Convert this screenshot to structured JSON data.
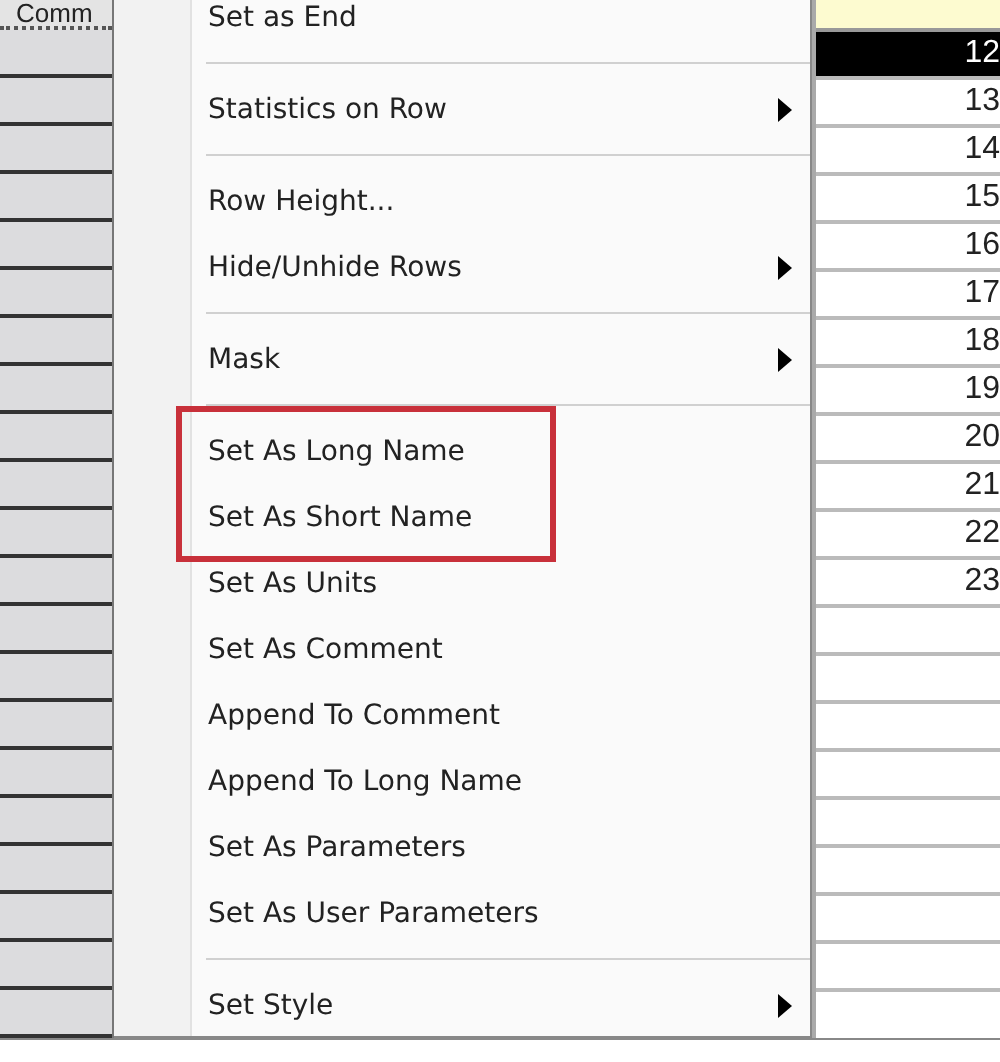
{
  "left_column": {
    "header": "Comm"
  },
  "menu": {
    "items": [
      {
        "kind": "item",
        "label": "Set as End",
        "submenu": false,
        "highlighted": false
      },
      {
        "kind": "separator"
      },
      {
        "kind": "item",
        "label": "Statistics on Row",
        "submenu": true,
        "highlighted": false
      },
      {
        "kind": "separator"
      },
      {
        "kind": "item",
        "label": "Row Height...",
        "submenu": false,
        "highlighted": false
      },
      {
        "kind": "item",
        "label": "Hide/Unhide Rows",
        "submenu": true,
        "highlighted": false
      },
      {
        "kind": "separator"
      },
      {
        "kind": "item",
        "label": "Mask",
        "submenu": true,
        "highlighted": false
      },
      {
        "kind": "separator"
      },
      {
        "kind": "item",
        "label": "Set As Long Name",
        "submenu": false,
        "highlighted": true
      },
      {
        "kind": "item",
        "label": "Set As Short Name",
        "submenu": false,
        "highlighted": true
      },
      {
        "kind": "item",
        "label": "Set As Units",
        "submenu": false,
        "highlighted": false
      },
      {
        "kind": "item",
        "label": "Set As Comment",
        "submenu": false,
        "highlighted": false
      },
      {
        "kind": "item",
        "label": "Append To Comment",
        "submenu": false,
        "highlighted": false
      },
      {
        "kind": "item",
        "label": "Append To Long Name",
        "submenu": false,
        "highlighted": false
      },
      {
        "kind": "item",
        "label": "Set As Parameters",
        "submenu": false,
        "highlighted": false
      },
      {
        "kind": "item",
        "label": "Set As User Parameters",
        "submenu": false,
        "highlighted": false
      },
      {
        "kind": "separator"
      },
      {
        "kind": "item",
        "label": "Set Style",
        "submenu": true,
        "highlighted": false
      }
    ]
  },
  "right_column": {
    "rows": [
      {
        "value": "12",
        "selected": true
      },
      {
        "value": "13",
        "selected": false
      },
      {
        "value": "14",
        "selected": false
      },
      {
        "value": "15",
        "selected": false
      },
      {
        "value": "16",
        "selected": false
      },
      {
        "value": "17",
        "selected": false
      },
      {
        "value": "18",
        "selected": false
      },
      {
        "value": "19",
        "selected": false
      },
      {
        "value": "20",
        "selected": false
      },
      {
        "value": "21",
        "selected": false
      },
      {
        "value": "22",
        "selected": false
      },
      {
        "value": "23",
        "selected": false
      }
    ]
  }
}
